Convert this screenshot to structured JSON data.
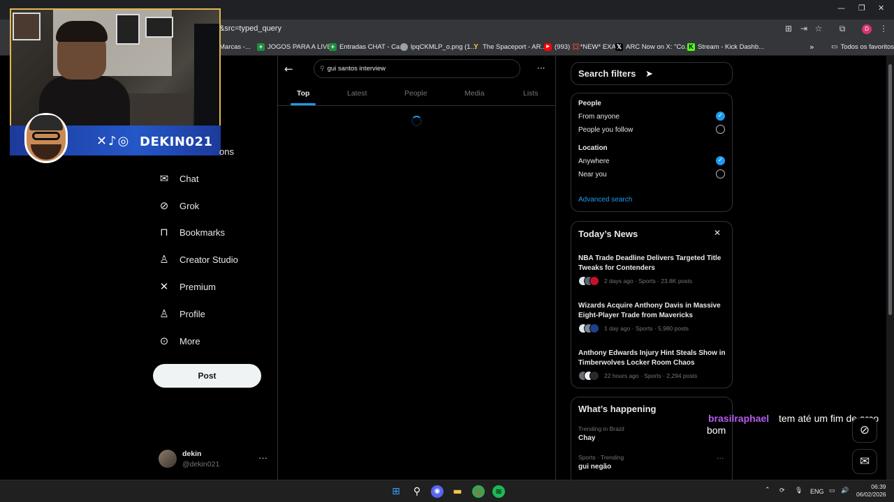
{
  "browser": {
    "url": "&src=typed_query",
    "window_controls": [
      "—",
      "❐",
      "✕"
    ],
    "bookmarks": [
      {
        "label": "Marcas -...",
        "icon": "bookmark-icon",
        "color": "#5f6368"
      },
      {
        "label": "JOGOS PARA A LIVE...",
        "icon": "sheets-icon",
        "color": "#1e8e3e"
      },
      {
        "label": "Entradas CHAT - Ca...",
        "icon": "sheets-icon",
        "color": "#1e8e3e"
      },
      {
        "label": "lpqCKMLP_o.png (1...",
        "icon": "globe-icon",
        "color": "#9aa0a6"
      },
      {
        "label": "The Spaceport - AR...",
        "icon": "spaceport-icon",
        "color": "#f2c94c"
      },
      {
        "label": "(993) 💢*NEW* EXA...",
        "icon": "youtube-icon",
        "color": "#ff0000"
      },
      {
        "label": "ARC Now on X: \"Co...",
        "icon": "x-icon",
        "color": "#000000"
      },
      {
        "label": "Stream - Kick Dashb...",
        "icon": "kick-icon",
        "color": "#53fc18"
      }
    ],
    "all_bookmarks": "Todos os favoritos",
    "profile_initial": "D"
  },
  "overlay": {
    "streamer_tag": "DEKIN021",
    "chat_user": "brasilraphael",
    "chat_message_line1": "tem até um fim de arco",
    "chat_message_line2": "bom"
  },
  "nav": {
    "partial_label": "ons",
    "items": [
      {
        "label": "Chat",
        "icon": "mail-icon"
      },
      {
        "label": "Grok",
        "icon": "grok-icon"
      },
      {
        "label": "Bookmarks",
        "icon": "bookmark-icon"
      },
      {
        "label": "Creator Studio",
        "icon": "creator-studio-icon"
      },
      {
        "label": "Premium",
        "icon": "x-logo-icon"
      },
      {
        "label": "Profile",
        "icon": "person-icon"
      },
      {
        "label": "More",
        "icon": "more-circle-icon"
      }
    ],
    "post_label": "Post"
  },
  "account": {
    "name": "dekin",
    "handle": "@dekin021",
    "more": "···"
  },
  "search": {
    "query": "gui santos interview",
    "tabs": [
      "Top",
      "Latest",
      "People",
      "Media",
      "Lists"
    ],
    "active_tab": "Top"
  },
  "filters": {
    "title": "Search filters",
    "people_label": "People",
    "people_options": [
      {
        "label": "From anyone",
        "selected": true
      },
      {
        "label": "People you follow",
        "selected": false
      }
    ],
    "location_label": "Location",
    "location_options": [
      {
        "label": "Anywhere",
        "selected": true
      },
      {
        "label": "Near you",
        "selected": false
      }
    ],
    "advanced": "Advanced search"
  },
  "news": {
    "title": "Today’s News",
    "items": [
      {
        "headline": "NBA Trade Deadline Delivers Targeted Title Tweaks for Contenders",
        "meta": "2 days ago · Sports · 23.8K posts"
      },
      {
        "headline": "Wizards Acquire Anthony Davis in Massive Eight-Player Trade from Mavericks",
        "meta": "1 day ago · Sports · 5,980 posts"
      },
      {
        "headline": "Anthony Edwards Injury Hint Steals Show in Timberwolves Locker Room Chaos",
        "meta": "22 hours ago · Sports · 2,294 posts"
      }
    ]
  },
  "happening": {
    "title": "What’s happening",
    "trends": [
      {
        "meta": "Trending in Brazil",
        "name": "Chay"
      },
      {
        "meta": "Sports · Trending",
        "name": "gui negão"
      }
    ]
  },
  "taskbar": {
    "lang": "ENG",
    "time": "06:39",
    "date": "06/02/2026"
  },
  "colors": {
    "accent": "#1d9bf0",
    "chat_user": "#b65cf0",
    "banner": "#2457c8"
  }
}
